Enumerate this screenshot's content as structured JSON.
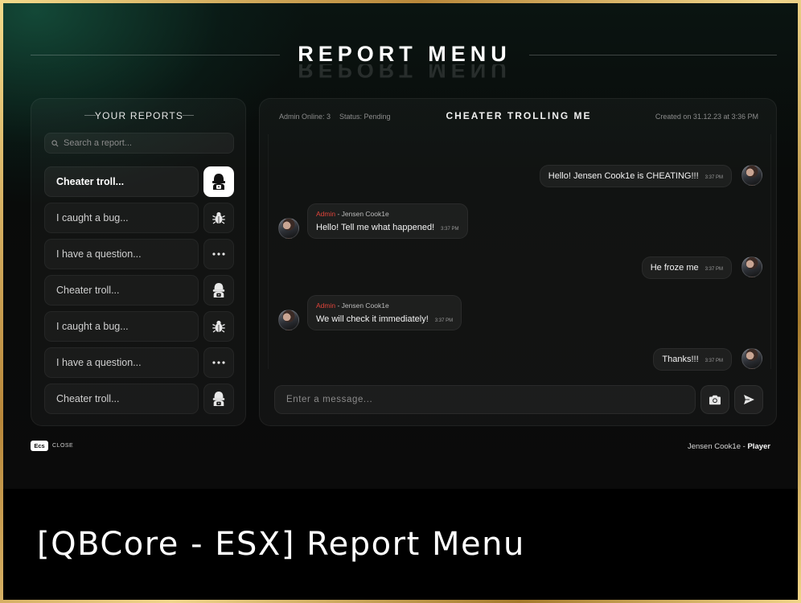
{
  "header": {
    "title": "REPORT MENU"
  },
  "sidebar": {
    "heading": "YOUR REPORTS",
    "search_placeholder": "Search a report...",
    "reports": [
      {
        "label": "Cheater troll...",
        "icon": "hacker-icon",
        "active": true
      },
      {
        "label": "I caught a bug...",
        "icon": "bug-icon",
        "active": false
      },
      {
        "label": "I have a question...",
        "icon": "ellipsis-icon",
        "active": false
      },
      {
        "label": "Cheater troll...",
        "icon": "hacker-icon",
        "active": false
      },
      {
        "label": "I caught a bug...",
        "icon": "bug-icon",
        "active": false
      },
      {
        "label": "I have a question...",
        "icon": "ellipsis-icon",
        "active": false
      },
      {
        "label": "Cheater troll...",
        "icon": "hacker-icon",
        "active": false
      }
    ]
  },
  "chat": {
    "admin_online": "Admin Online: 3",
    "status": "Status: Pending",
    "title": "CHEATER TROLLING ME",
    "created": "Created on 31.12.23 at 3:36 PM",
    "messages": [
      {
        "side": "right",
        "text": "Hello! Jensen Cook1e is CHEATING!!!",
        "time": "3:37 PM"
      },
      {
        "side": "left",
        "role": "Admin",
        "sender": " - Jensen Cook1e",
        "text": "Hello! Tell me what happened!",
        "time": "3:37 PM"
      },
      {
        "side": "right",
        "text": "He froze me",
        "time": "3:37 PM"
      },
      {
        "side": "left",
        "role": "Admin",
        "sender": " - Jensen Cook1e",
        "text": "We will check it immediately!",
        "time": "3:37 PM"
      },
      {
        "side": "right",
        "text": "Thanks!!!",
        "time": "3:37 PM"
      }
    ],
    "input_placeholder": "Enter a message...",
    "camera_icon": "camera-icon",
    "send_icon": "send-icon"
  },
  "footer": {
    "esc_key": "Ecs",
    "close_label": "CLOSE",
    "player_name": "Jensen Cook1e",
    "player_sep": " - ",
    "player_role": "Player"
  },
  "banner": {
    "title": "[QBCore - ESX] Report Menu"
  }
}
